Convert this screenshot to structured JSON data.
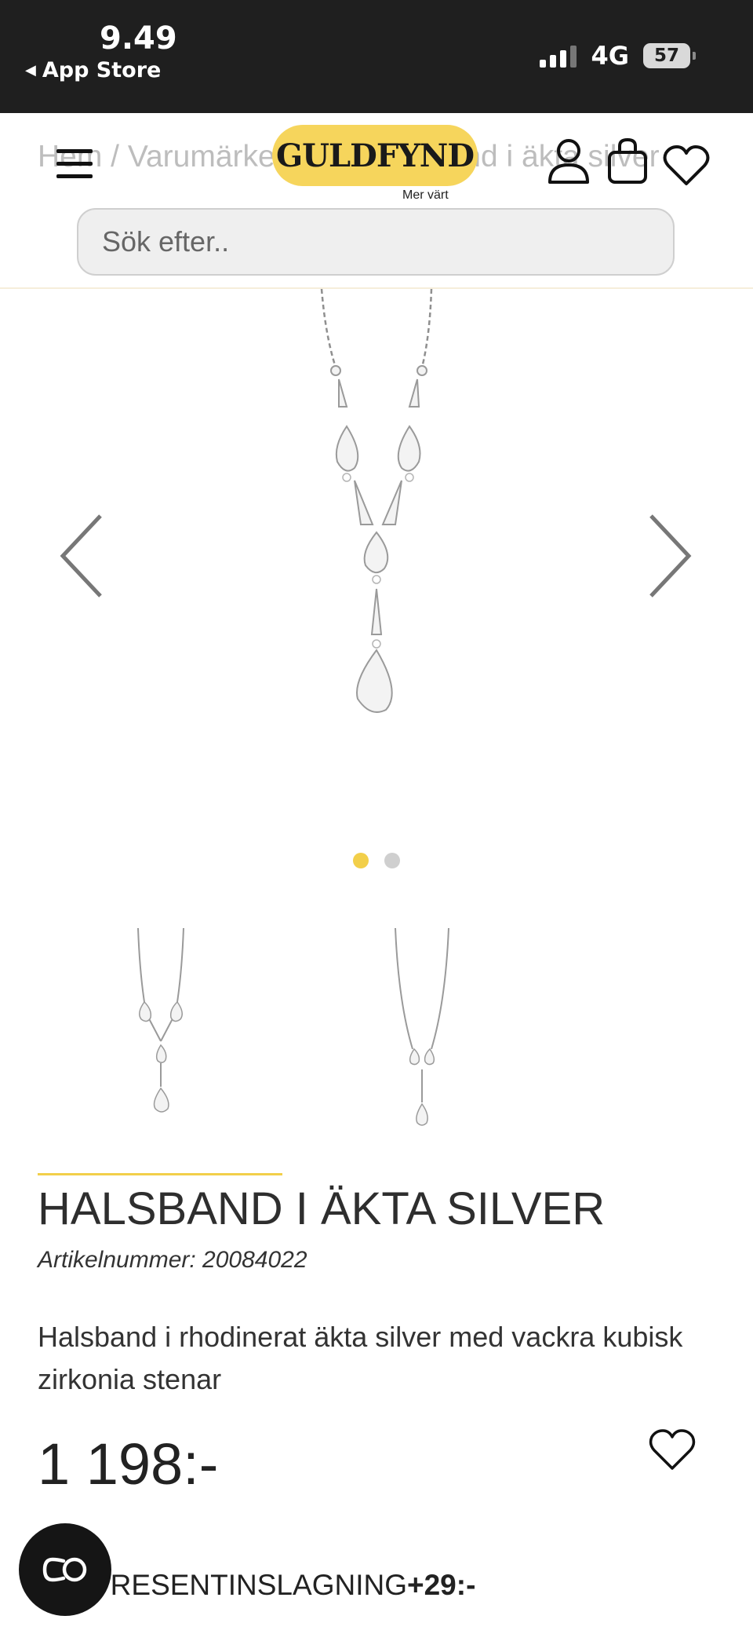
{
  "status_bar": {
    "time": "9.49",
    "back_label": "App Store",
    "network": "4G",
    "battery": "57"
  },
  "header": {
    "breadcrumb": "Hem / Varumärken / ... / Halsband i äkta silver",
    "logo_text": "GULDFYND",
    "logo_tagline": "Mer värt",
    "search_placeholder": "Sök efter..",
    "icons": [
      "menu-icon",
      "user-icon",
      "bag-icon",
      "heart-icon"
    ]
  },
  "gallery": {
    "image_count": 2,
    "active_index": 0,
    "prev_icon": "chevron-left-icon",
    "next_icon": "chevron-right-icon"
  },
  "product": {
    "title": "HALSBAND I ÄKTA SILVER",
    "article_number": "Artikelnummer: 20084022",
    "description": "Halsband i rhodinerat äkta silver med vackra kubisk zirkonia stenar",
    "price": "1 198:-",
    "gift_wrap_label": "PRESENTINSLAGNING",
    "gift_wrap_price": "+29:-"
  },
  "colors": {
    "accent": "#f2cf4a",
    "status_bar": "#1f1f1f"
  }
}
